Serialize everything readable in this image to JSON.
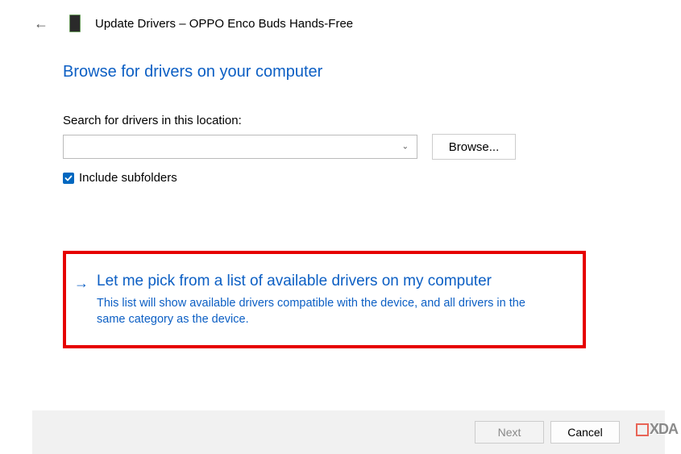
{
  "titlebar": {
    "title": "Update Drivers – OPPO Enco Buds Hands-Free"
  },
  "heading": "Browse for drivers on your computer",
  "search": {
    "label": "Search for drivers in this location:",
    "location_value": "",
    "browse_label": "Browse..."
  },
  "subfolders": {
    "checked": true,
    "label": "Include subfolders"
  },
  "option": {
    "title": "Let me pick from a list of available drivers on my computer",
    "desc": "This list will show available drivers compatible with the device, and all drivers in the same category as the device."
  },
  "footer": {
    "next_label": "Next",
    "cancel_label": "Cancel"
  },
  "watermark": "XDA"
}
